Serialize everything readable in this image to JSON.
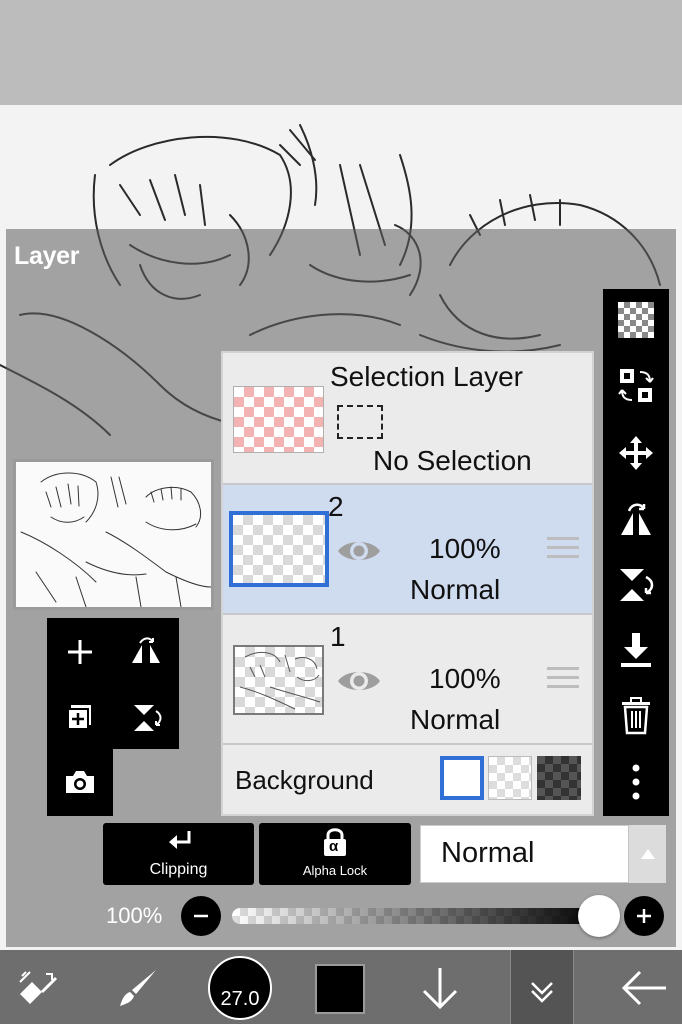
{
  "panel": {
    "title": "Layer"
  },
  "layers": {
    "selection": {
      "title": "Selection Layer",
      "status": "No Selection"
    },
    "items": [
      {
        "number": "2",
        "opacity": "100%",
        "blend": "Normal",
        "selected": true
      },
      {
        "number": "1",
        "opacity": "100%",
        "blend": "Normal",
        "selected": false
      }
    ],
    "background_label": "Background"
  },
  "left_tools": {
    "icons": [
      "add-layer-icon",
      "flip-horizontal-icon",
      "add-page-icon",
      "flip-vertical-icon",
      "camera-icon"
    ]
  },
  "right_tools": {
    "icons": [
      "transparent-checker-icon",
      "layer-convert-icon",
      "move-icon",
      "flip-rotate-horizontal-icon",
      "flip-rotate-vertical-icon",
      "merge-down-icon",
      "trash-icon",
      "more-vertical-icon"
    ]
  },
  "controls": {
    "clipping_label": "Clipping",
    "alpha_lock_label": "Alpha Lock",
    "alpha_symbol": "α",
    "blend_mode": "Normal",
    "opacity_label": "100%",
    "opacity_value": 1.0,
    "minus": "−",
    "plus": "+"
  },
  "bottom_bar": {
    "brush_size": "27.0",
    "icons": [
      "transform-icon",
      "brush-icon",
      "brush-size-indicator",
      "color-swatch",
      "arrow-down-icon",
      "collapse-icon",
      "back-arrow-icon"
    ],
    "color": "#000000"
  },
  "colors": {
    "selected_row": "#cfdbee",
    "accent_blue": "#2f6fd6"
  }
}
